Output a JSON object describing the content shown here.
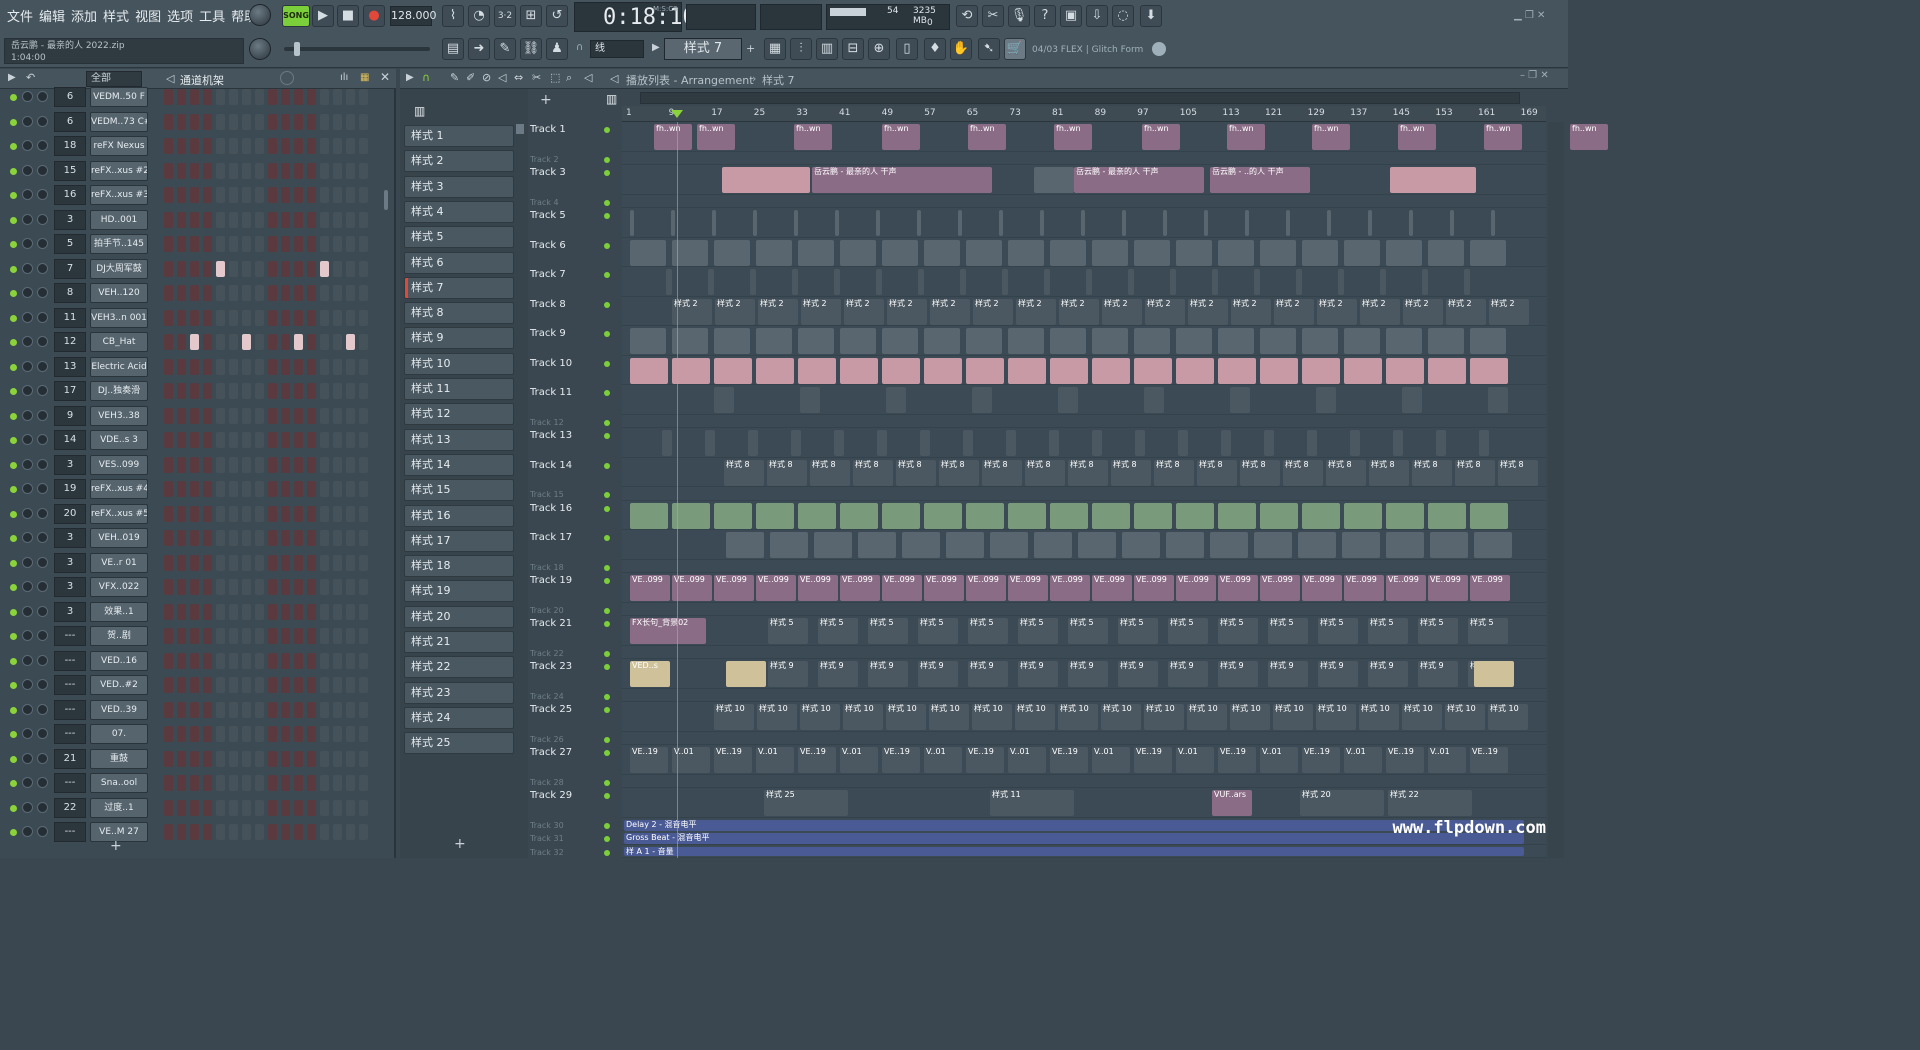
{
  "menu": [
    "文件",
    "编辑",
    "添加",
    "样式",
    "视图",
    "选项",
    "工具",
    "帮助"
  ],
  "song": {
    "file": "岳云鹏 - 最亲的人 2022.zip",
    "time_elapsed": "1:04:00"
  },
  "transport": {
    "mode": "SONG",
    "tempo": "128.000",
    "time": "0:18:10",
    "time_unit": "M:S:CS"
  },
  "monitor": {
    "cpu": "54",
    "memory": "3235 MB",
    "polyphony": "0"
  },
  "snap_label": "线",
  "pattern_selector": "样式 7",
  "hint_bar": "04/03  FLEX | Glitch Form",
  "rack": {
    "filter": "全部",
    "title": "通道机架",
    "channels": [
      {
        "mix": "6",
        "name": "VEDM..50 F"
      },
      {
        "mix": "6",
        "name": "VEDM..73 C#"
      },
      {
        "mix": "18",
        "name": "reFX Nexus"
      },
      {
        "mix": "15",
        "name": "reFX..xus #2"
      },
      {
        "mix": "16",
        "name": "reFX..xus #3"
      },
      {
        "mix": "3",
        "name": "HD..001"
      },
      {
        "mix": "5",
        "name": "拍手节..145"
      },
      {
        "mix": "7",
        "name": "DJ大周军鼓"
      },
      {
        "mix": "8",
        "name": "VEH..120"
      },
      {
        "mix": "11",
        "name": "VEH3..n 001"
      },
      {
        "mix": "12",
        "name": "CB_Hat"
      },
      {
        "mix": "13",
        "name": "Electric Acid"
      },
      {
        "mix": "17",
        "name": "DJ..独奏滑"
      },
      {
        "mix": "9",
        "name": "VEH3..38"
      },
      {
        "mix": "14",
        "name": "VDE..s 3"
      },
      {
        "mix": "3",
        "name": "VES..099"
      },
      {
        "mix": "19",
        "name": "reFX..xus #4"
      },
      {
        "mix": "20",
        "name": "reFX..xus #5"
      },
      {
        "mix": "3",
        "name": "VEH..019"
      },
      {
        "mix": "3",
        "name": "VE..r 01"
      },
      {
        "mix": "3",
        "name": "VFX..022"
      },
      {
        "mix": "3",
        "name": "效果..1"
      },
      {
        "mix": "---",
        "name": "贺..剧"
      },
      {
        "mix": "---",
        "name": "VED..16"
      },
      {
        "mix": "---",
        "name": "VED..#2"
      },
      {
        "mix": "---",
        "name": "VED..39"
      },
      {
        "mix": "---",
        "name": "07."
      },
      {
        "mix": "21",
        "name": "重鼓"
      },
      {
        "mix": "---",
        "name": "Sna..ool"
      },
      {
        "mix": "22",
        "name": "过度..1"
      },
      {
        "mix": "---",
        "name": "VE..M 27"
      }
    ]
  },
  "patterns": [
    "样式 1",
    "样式 2",
    "样式 3",
    "样式 4",
    "样式 5",
    "样式 6",
    "样式 7",
    "样式 8",
    "样式 9",
    "样式 10",
    "样式 11",
    "样式 12",
    "样式 13",
    "样式 14",
    "样式 15",
    "样式 16",
    "样式 17",
    "样式 18",
    "样式 19",
    "样式 20",
    "样式 21",
    "样式 22",
    "样式 23",
    "样式 24",
    "样式 25"
  ],
  "playlist": {
    "title": "播放列表 - Arrangement",
    "current": "样式 7",
    "ruler": [
      "1",
      "9",
      "17",
      "25",
      "33",
      "41",
      "49",
      "57",
      "65",
      "73",
      "81",
      "89",
      "97",
      "105",
      "113",
      "121",
      "129",
      "137",
      "145",
      "153",
      "161",
      "169"
    ]
  },
  "tracks": [
    {
      "name": "Track 1",
      "big": true
    },
    {
      "name": "Track 2",
      "big": false
    },
    {
      "name": "Track 3",
      "big": true
    },
    {
      "name": "Track 4",
      "big": false
    },
    {
      "name": "Track 5",
      "big": true
    },
    {
      "name": "Track 6",
      "big": true
    },
    {
      "name": "Track 7",
      "big": true
    },
    {
      "name": "Track 8",
      "big": true
    },
    {
      "name": "Track 9",
      "big": true
    },
    {
      "name": "Track 10",
      "big": true
    },
    {
      "name": "Track 11",
      "big": true
    },
    {
      "name": "Track 12",
      "big": false
    },
    {
      "name": "Track 13",
      "big": true
    },
    {
      "name": "Track 14",
      "big": true
    },
    {
      "name": "Track 15",
      "big": false
    },
    {
      "name": "Track 16",
      "big": true
    },
    {
      "name": "Track 17",
      "big": true
    },
    {
      "name": "Track 18",
      "big": false
    },
    {
      "name": "Track 19",
      "big": true
    },
    {
      "name": "Track 20",
      "big": false
    },
    {
      "name": "Track 21",
      "big": true
    },
    {
      "name": "Track 22",
      "big": false
    },
    {
      "name": "Track 23",
      "big": true
    },
    {
      "name": "Track 24",
      "big": false
    },
    {
      "name": "Track 25",
      "big": true
    },
    {
      "name": "Track 26",
      "big": false
    },
    {
      "name": "Track 27",
      "big": true
    },
    {
      "name": "Track 28",
      "big": false
    },
    {
      "name": "Track 29",
      "big": true
    },
    {
      "name": "Track 30",
      "big": false
    },
    {
      "name": "Track 31",
      "big": false
    },
    {
      "name": "Track 32",
      "big": false
    }
  ],
  "clip_labels": {
    "t1": "fh..wn",
    "t3": [
      "岳云鹏 - 最亲的人 干声",
      "岳云鹏 - 最亲的人 干声",
      "岳云鹏 - ..的人 干声"
    ],
    "t8": "样式 2",
    "t14": "样式 8",
    "t19": "VE..099",
    "t21a": "FX长句_背景02",
    "t21b": "样式 5",
    "t23a": "VED..s",
    "t23b": "样式 9",
    "t25": "样式 10",
    "t27a": "VE..19",
    "t27b": "V..01",
    "t29": [
      "样式 25",
      "样式 11",
      "VUF..ars",
      "样式 20",
      "样式 22"
    ],
    "t30": "Delay 2 - 混音电平",
    "t31": "Gross Beat - 混音电平",
    "t32": "样 A 1 - 音量"
  },
  "watermark": "www.flpdown.com",
  "colors": {
    "accent_green": "#8bd33a",
    "record_red": "#e2483a",
    "clip_pink": "#c89aa6",
    "clip_mauve": "#8a6c86",
    "background": "#3a4750"
  }
}
